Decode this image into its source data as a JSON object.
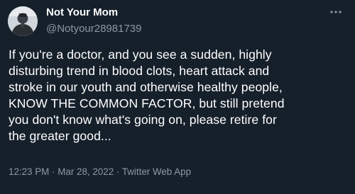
{
  "author": {
    "display_name": "Not Your Mom",
    "handle": "@Notyour28981739",
    "avatar_icon": "profile-photo"
  },
  "more_icon": "more-horizontal-icon",
  "tweet": {
    "text": "If you're a doctor, and you see a sudden, highly\ndisturbing trend in blood clots, heart attack and\nstroke in our youth and otherwise healthy people,\nKNOW THE COMMON FACTOR, but still pretend\nyou don't know what's going on, please retire for\nthe greater good..."
  },
  "meta": {
    "time": "12:23 PM",
    "sep1": " · ",
    "date": "Mar 28, 2022",
    "sep2": " · ",
    "source": "Twitter Web App"
  },
  "colors": {
    "background": "#15202b",
    "primary_text": "#ffffff",
    "secondary_text": "#8b98a5"
  }
}
